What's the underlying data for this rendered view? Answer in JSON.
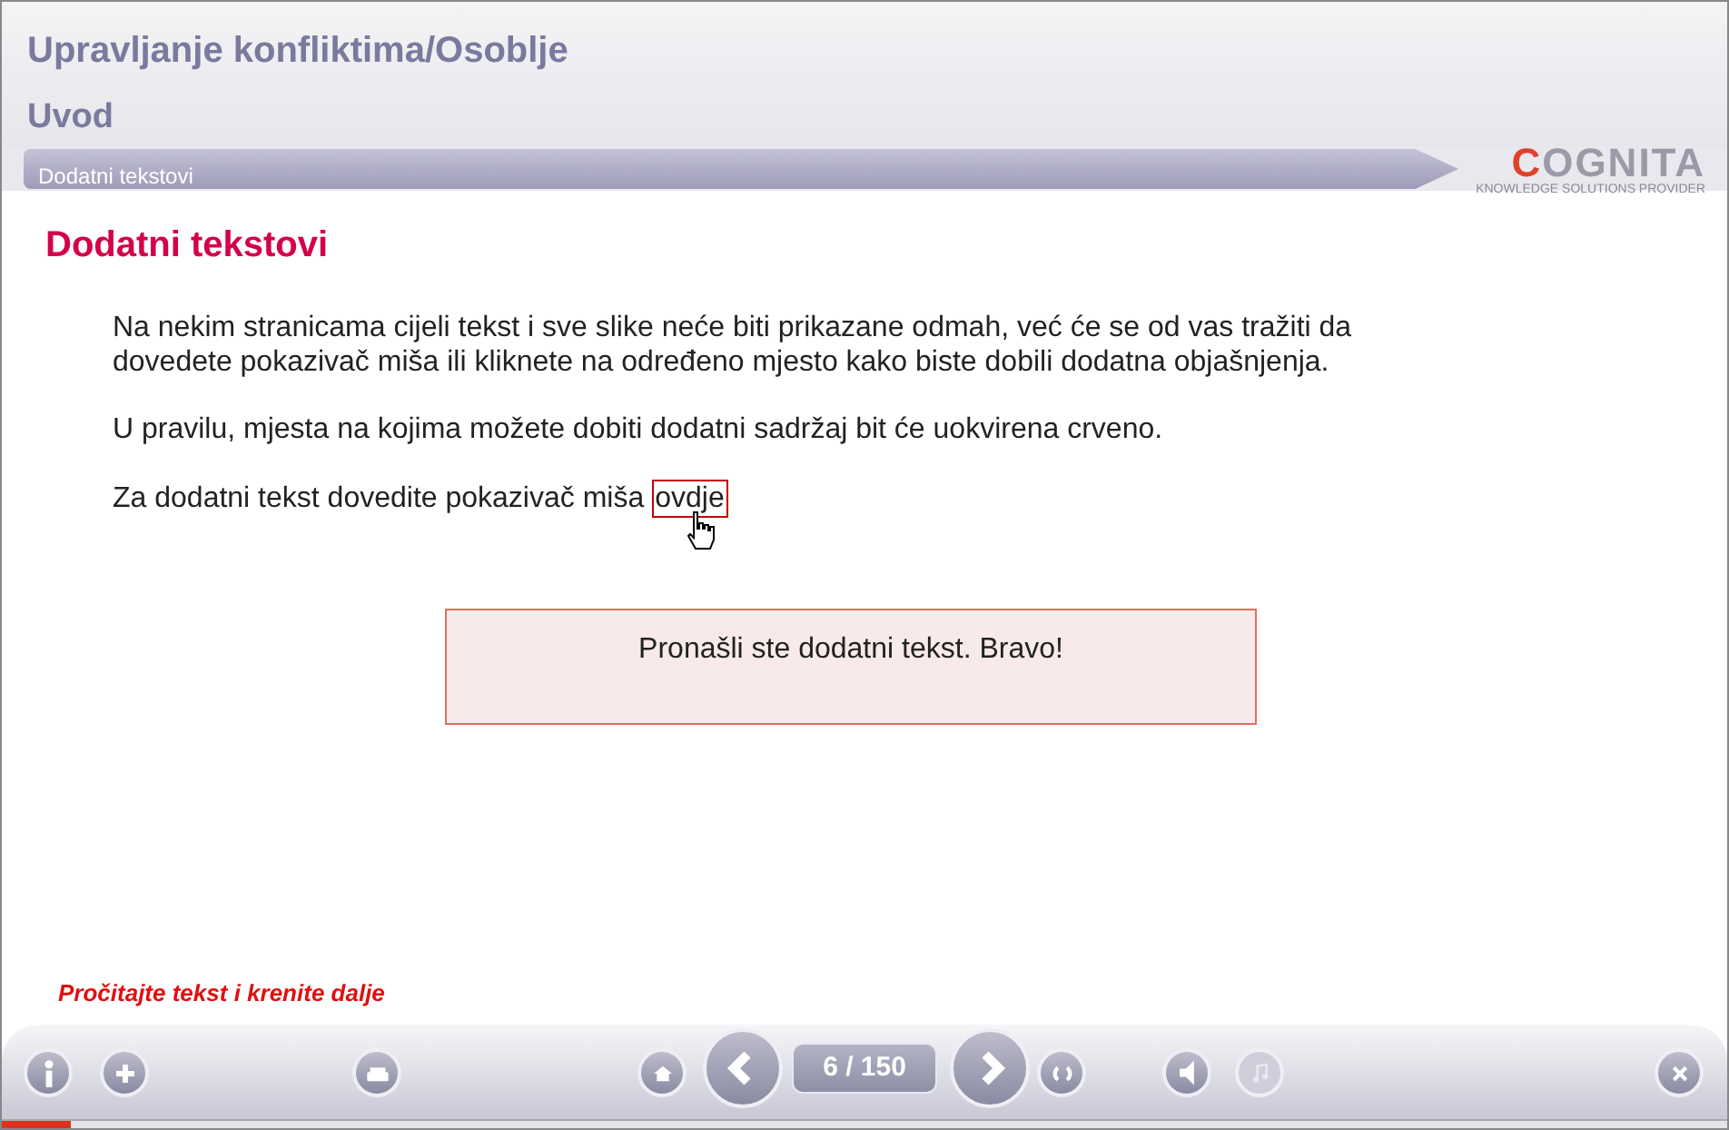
{
  "course_title": "Upravljanje konfliktima/Osoblje",
  "module_title": "Uvod",
  "page_bar": {
    "title": "Dodatni tekstovi"
  },
  "logo": {
    "brand_first": "C",
    "brand_rest": "OGNITA",
    "tagline": "KNOWLEDGE SOLUTIONS PROVIDER"
  },
  "heading": "Dodatni tekstovi",
  "paragraphs": [
    "Na nekim stranicama cijeli tekst i sve slike neće biti prikazane odmah, već će se od vas tražiti da dovedete pokazivač miša ili kliknete na određeno mjesto kako biste dobili dodatna objašnjenja.",
    "U pravilu, mjesta na kojima možete dobiti dodatni sadržaj bit će uokvirena crveno."
  ],
  "hotspot_line": {
    "text": "Za dodatni tekst dovedite pokazivač miša",
    "link": "ovdje"
  },
  "popup": {
    "text": "Pronašli ste dodatni tekst. Bravo!"
  },
  "instruction": "Pročitajte tekst i krenite dalje",
  "toolbar": [
    {
      "kind": "info",
      "disabled": false
    },
    {
      "kind": "plus",
      "disabled": false
    },
    {
      "kind": "print",
      "disabled": false
    },
    {
      "kind": "home",
      "disabled": false
    },
    {
      "kind": "prev",
      "disabled": false
    },
    {
      "kind": "counter",
      "text": "6 / 150"
    },
    {
      "kind": "next",
      "disabled": false
    },
    {
      "kind": "refresh",
      "disabled": false
    },
    {
      "kind": "sound",
      "disabled": false
    },
    {
      "kind": "music",
      "disabled": true
    },
    {
      "kind": "close",
      "disabled": false
    }
  ],
  "progress": {
    "level": 0.04
  }
}
